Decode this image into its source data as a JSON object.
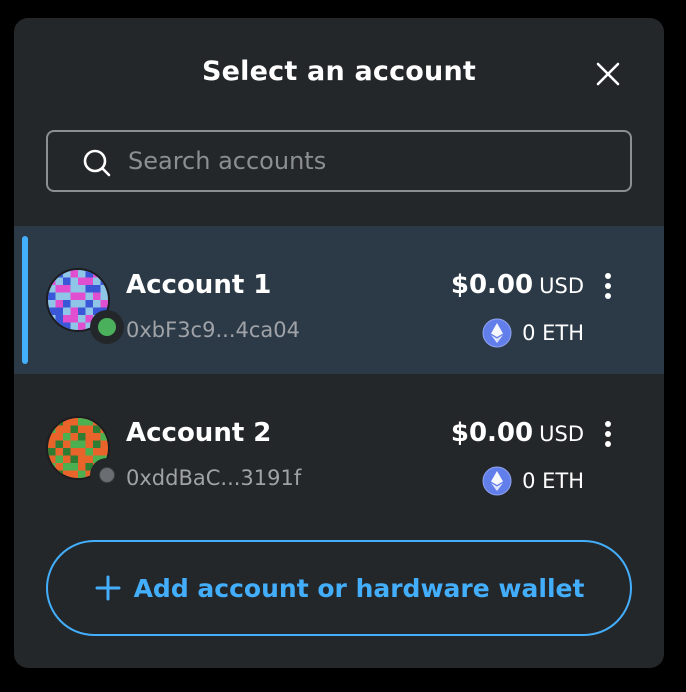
{
  "modal": {
    "title": "Select an account"
  },
  "search": {
    "placeholder": "Search accounts",
    "value": ""
  },
  "accounts": [
    {
      "name": "Account 1",
      "address": "0xbF3c9...4ca04",
      "fiat_amount": "$0.00",
      "fiat_currency": "USD",
      "token_amount": "0 ETH",
      "selected": true,
      "connected": true
    },
    {
      "name": "Account 2",
      "address": "0xddBaC...3191f",
      "fiat_amount": "$0.00",
      "fiat_currency": "USD",
      "token_amount": "0 ETH",
      "selected": false,
      "connected": false
    }
  ],
  "add_button": {
    "label": "Add account or hardware wallet"
  },
  "icons": {
    "close": "close-icon",
    "search": "search-icon",
    "kebab": "kebab-menu-icon",
    "eth": "eth-icon",
    "plus": "plus-icon"
  },
  "colors": {
    "background": "#24272a",
    "selected_row": "#2c3a47",
    "accent": "#43aefc",
    "connected": "#4bb05b",
    "muted_text": "#9fa2a7"
  }
}
